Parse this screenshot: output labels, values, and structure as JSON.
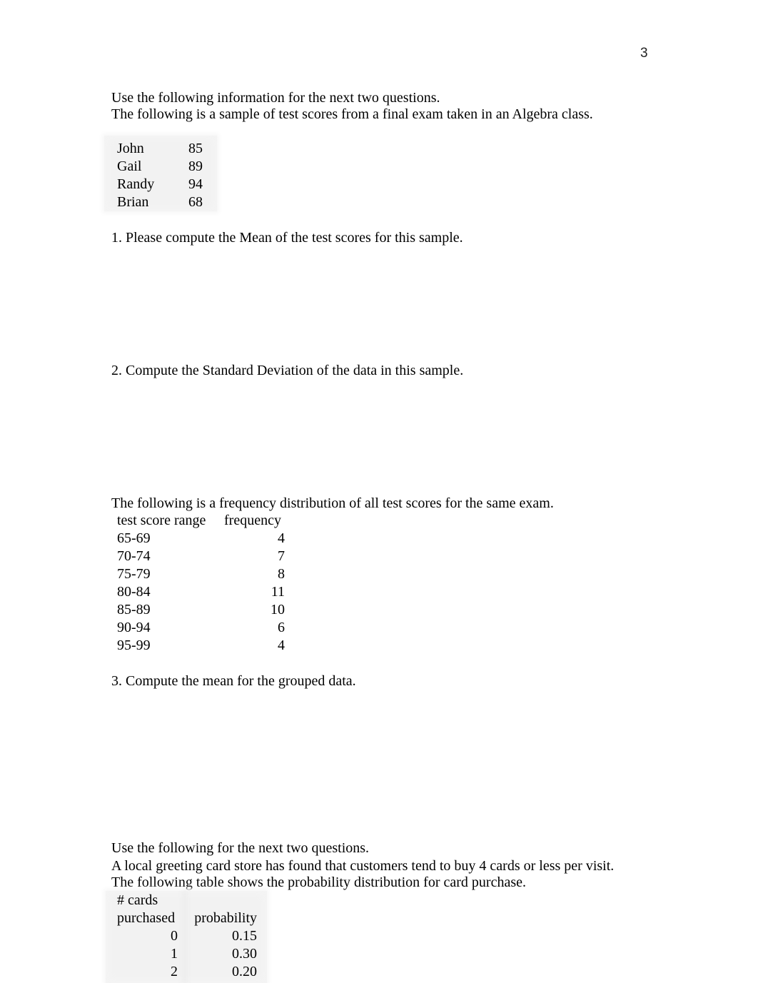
{
  "page_number": "3",
  "section1": {
    "intro_line1": "Use the following information for the next two questions.",
    "intro_line2": "The following is a sample of test scores from a final exam taken in an Algebra class.",
    "scores": [
      {
        "name": "John",
        "score": "85"
      },
      {
        "name": "Gail",
        "score": "89"
      },
      {
        "name": "Randy",
        "score": "94"
      },
      {
        "name": "Brian",
        "score": "68"
      }
    ]
  },
  "questions": {
    "q1": "1.  Please compute the Mean of the test scores for this sample.",
    "q2": "2. Compute the Standard Deviation of the data in this sample.",
    "q3": "3.  Compute the mean for the grouped data."
  },
  "frequency_distribution": {
    "intro": "The following is a frequency distribution of all test scores for the same exam.",
    "headers": [
      "test score range",
      "frequency"
    ],
    "rows": [
      {
        "range": "65-69",
        "frequency": "4"
      },
      {
        "range": "70-74",
        "frequency": "7"
      },
      {
        "range": "75-79",
        "frequency": "8"
      },
      {
        "range": "80-84",
        "frequency": "11"
      },
      {
        "range": "85-89",
        "frequency": "10"
      },
      {
        "range": "90-94",
        "frequency": "6"
      },
      {
        "range": "95-99",
        "frequency": "4"
      }
    ]
  },
  "section2": {
    "intro_line1": "Use the following for the next two questions.",
    "intro_line2": "A local greeting card store has found that customers tend to buy 4 cards or less per visit.",
    "intro_line3": "The following table shows the probability distribution for card purchase.",
    "headers": {
      "col1_line1": "# cards",
      "col1_line2": "purchased",
      "col2": "probability"
    },
    "rows": [
      {
        "cards": "0",
        "probability": "0.15"
      },
      {
        "cards": "1",
        "probability": "0.30"
      },
      {
        "cards": "2",
        "probability": "0.20"
      }
    ]
  }
}
